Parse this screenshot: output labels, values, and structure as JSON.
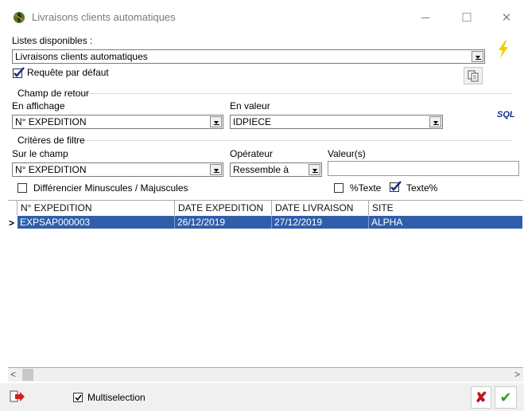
{
  "window": {
    "title": "Livraisons clients automatiques",
    "minimize_glyph": "─",
    "maximize_glyph": "☐",
    "close_glyph": "✕",
    "app_icon": "app-icon"
  },
  "lists": {
    "label": "Listes disponibles :",
    "selected": "Livraisons clients automatiques",
    "default_query_label": "Requête par défaut",
    "default_query_checked": true
  },
  "sql_label": "SQL",
  "return_field": {
    "group_label": "Champ de retour",
    "display_label": "En affichage",
    "display_value": "N° EXPEDITION",
    "value_label": "En valeur",
    "value_value": "IDPIECE"
  },
  "filter": {
    "group_label": "Critères de filtre",
    "field_label": "Sur le champ",
    "field_value": "N° EXPEDITION",
    "operator_label": "Opérateur",
    "operator_value": "Ressemble à",
    "values_label": "Valeur(s)",
    "values_value": "",
    "case_label": "Différencier Minuscules / Majuscules",
    "case_checked": false,
    "pct_text_label": "%Texte",
    "pct_text_checked": false,
    "text_pct_label": "Texte%",
    "text_pct_checked": true
  },
  "table": {
    "columns": [
      "N° EXPEDITION",
      "DATE EXPEDITION",
      "DATE LIVRAISON",
      "SITE"
    ],
    "rows": [
      [
        "EXPSAP000003",
        "26/12/2019",
        "27/12/2019",
        "ALPHA"
      ]
    ],
    "row_indicator": ">"
  },
  "scroll": {
    "left": "<",
    "right": ">"
  },
  "footer": {
    "multiselection_label": "Multiselection",
    "multiselection_checked": true,
    "cancel_glyph": "✘",
    "ok_glyph": "✔"
  },
  "colors": {
    "selection": "#2f5eaa",
    "ok": "#2e9e2e",
    "cancel": "#c0141c",
    "lightning": "#f2d000"
  }
}
